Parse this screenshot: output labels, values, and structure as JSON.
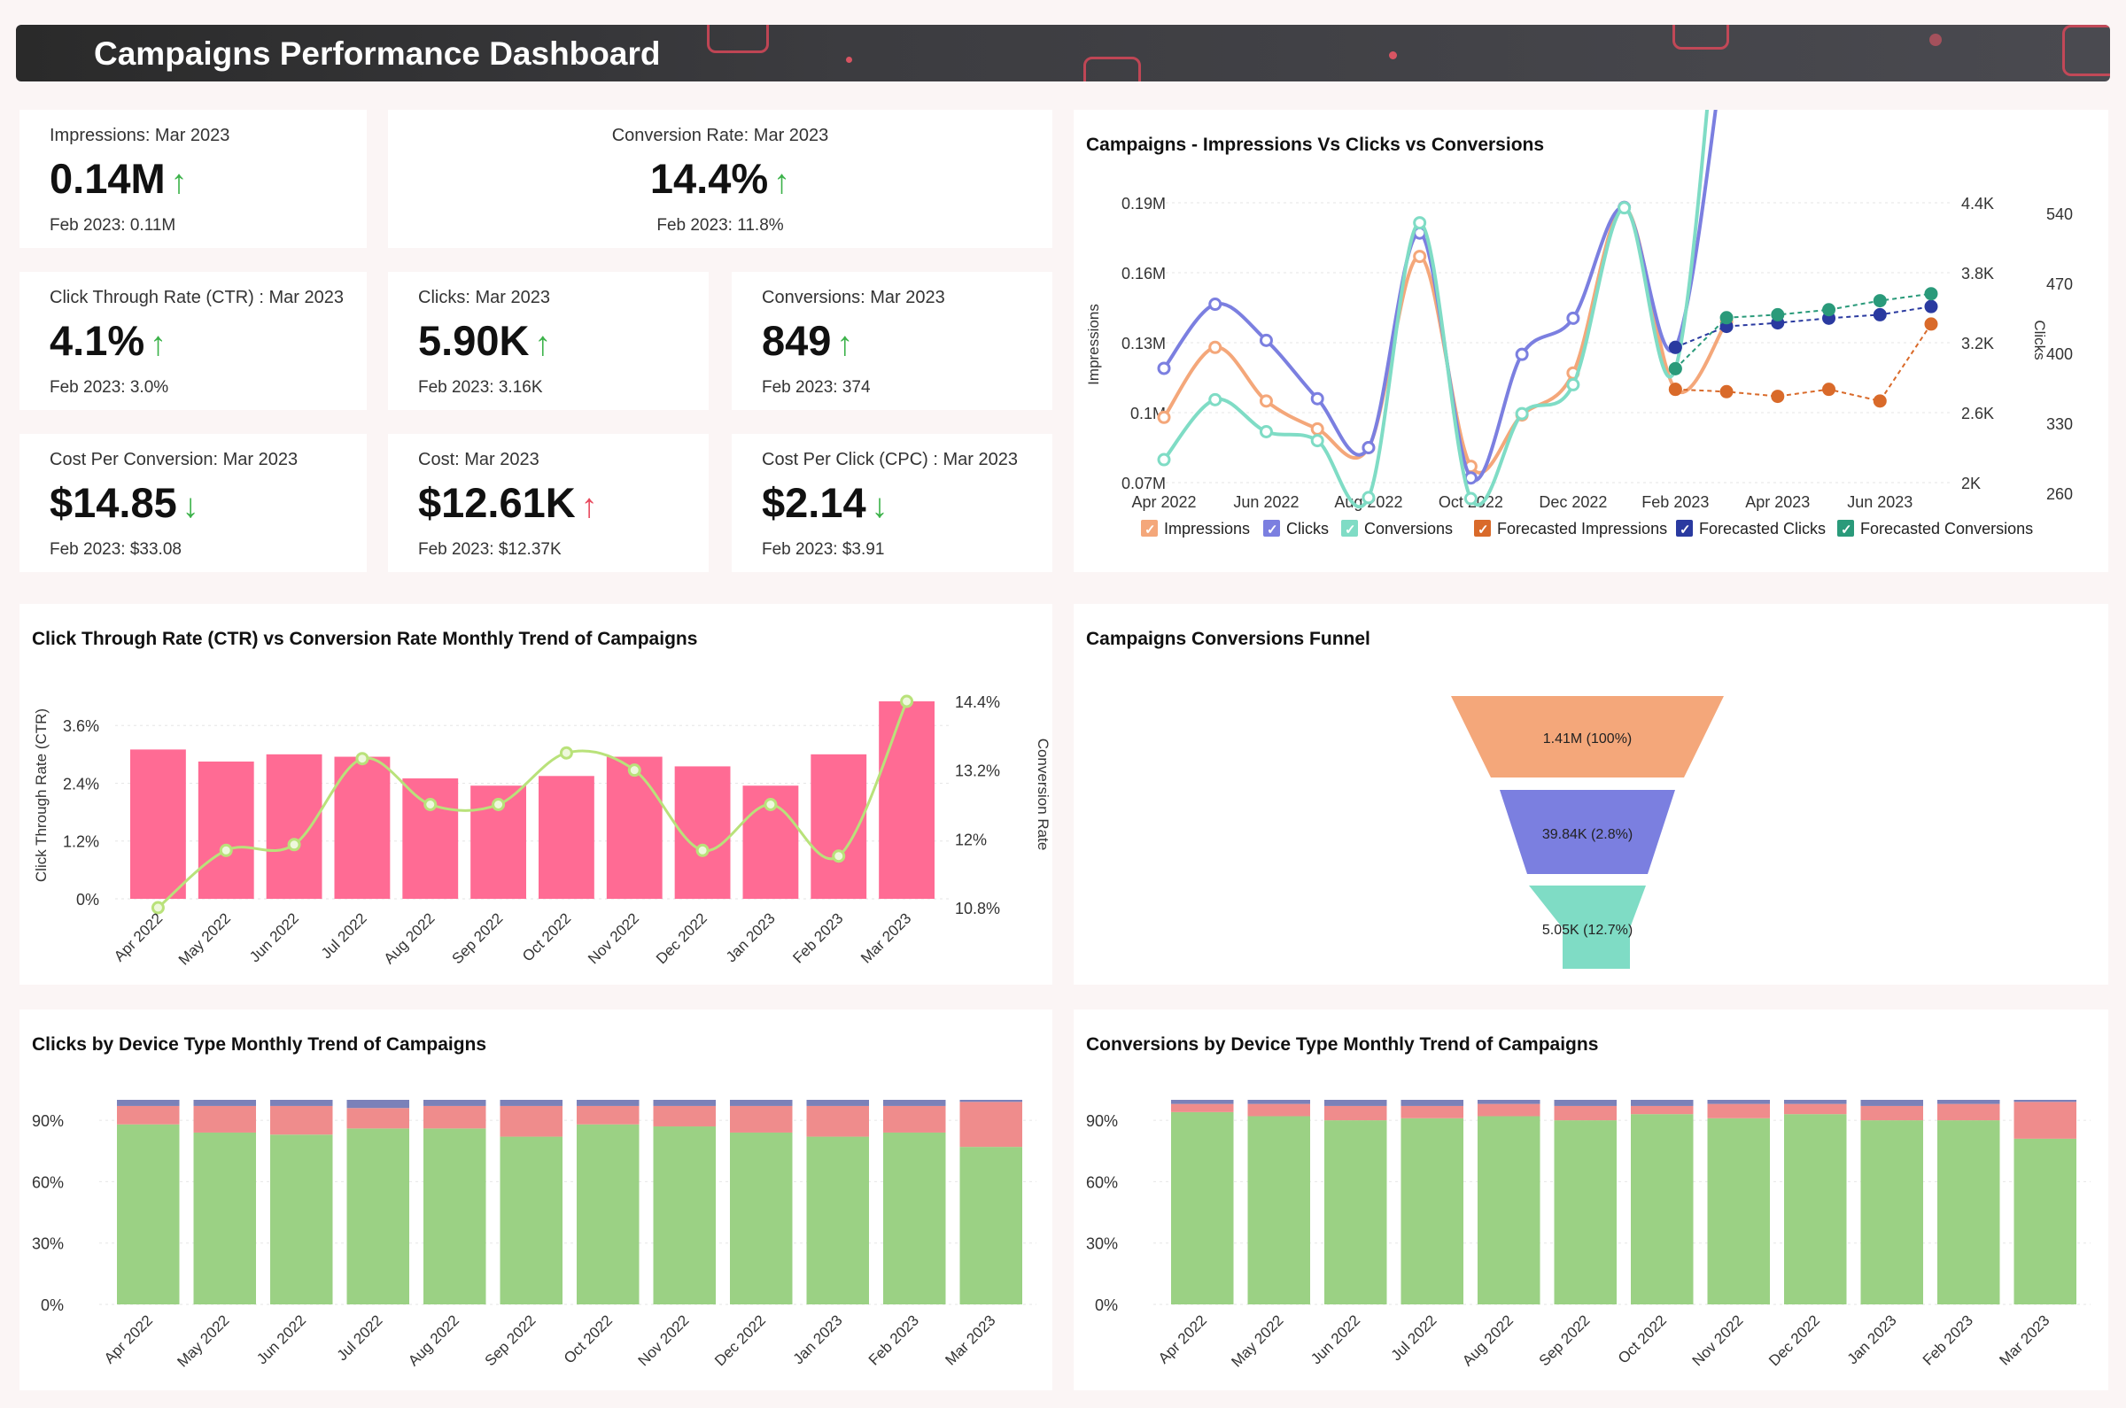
{
  "header": {
    "title": "Campaigns Performance Dashboard"
  },
  "kpis": {
    "impressions": {
      "label": "Impressions: Mar 2023",
      "value": "0.14M",
      "arrow": "↑",
      "prev": "Feb 2023: 0.11M"
    },
    "conversion_rate": {
      "label": "Conversion Rate: Mar 2023",
      "value": "14.4%",
      "arrow": "↑",
      "prev": "Feb 2023: 11.8%"
    },
    "ctr": {
      "label": "Click Through Rate (CTR) : Mar 2023",
      "value": "4.1%",
      "arrow": "↑",
      "prev": "Feb 2023: 3.0%"
    },
    "clicks": {
      "label": "Clicks: Mar 2023",
      "value": "5.90K",
      "arrow": "↑",
      "prev": "Feb 2023: 3.16K"
    },
    "conversions": {
      "label": "Conversions: Mar 2023",
      "value": "849",
      "arrow": "↑",
      "prev": "Feb 2023: 374"
    },
    "cost_per_conversion": {
      "label": "Cost Per Conversion: Mar 2023",
      "value": "$14.85",
      "arrow": "↓",
      "prev": "Feb 2023: $33.08"
    },
    "cost": {
      "label": "Cost: Mar 2023",
      "value": "$12.61K",
      "arrow": "↑",
      "prev": "Feb 2023: $12.37K"
    },
    "cpc": {
      "label": "Cost Per Click (CPC) : Mar 2023",
      "value": "$2.14",
      "arrow": "↓",
      "prev": "Feb 2023: $3.91"
    }
  },
  "colors": {
    "orange": "#f4a77a",
    "purple": "#7b7fe0",
    "teal": "#7fdcc5",
    "pink": "#ff6b94",
    "lightgreen": "#b9e27a",
    "green": "#9bd184",
    "red": "#ef8c8c",
    "slate": "#7b81b9",
    "forecast_orange": "#d96a2a",
    "forecast_blue": "#2a3aa0",
    "forecast_teal": "#2a9a7a"
  },
  "chart_data": [
    {
      "id": "impressions_clicks_conversions",
      "type": "line",
      "title": "Campaigns - Impressions Vs Clicks vs Conversions",
      "x_tick_labels": [
        "Apr 2022",
        "Jun 2022",
        "Aug 2022",
        "Oct 2022",
        "Dec 2022",
        "Feb 2023",
        "Apr 2023",
        "Jun 2023"
      ],
      "months": [
        "Apr 2022",
        "May 2022",
        "Jun 2022",
        "Jul 2022",
        "Aug 2022",
        "Sep 2022",
        "Oct 2022",
        "Nov 2022",
        "Dec 2022",
        "Jan 2023",
        "Feb 2023",
        "Mar 2023",
        "Apr 2023",
        "May 2023",
        "Jun 2023",
        "Jul 2023"
      ],
      "y_left": {
        "label": "Impressions",
        "ticks": [
          "0.19M",
          "0.16M",
          "0.13M",
          "0.1M",
          "0.07M"
        ],
        "range": [
          70000,
          190000
        ]
      },
      "y_right1": {
        "label": "Clicks",
        "ticks": [
          "4.4K",
          "3.8K",
          "3.2K",
          "2.6K",
          "2K"
        ],
        "range": [
          2000,
          4400
        ]
      },
      "y_right2": {
        "label": "Conversions",
        "ticks": [
          "540",
          "470",
          "400",
          "330",
          "260"
        ],
        "range": [
          260,
          540
        ]
      },
      "series": [
        {
          "name": "Impressions",
          "axis": "left",
          "values": [
            98000,
            128000,
            105000,
            93000,
            85000,
            167000,
            77000,
            99000,
            117000,
            188000,
            110000,
            139000
          ]
        },
        {
          "name": "Clicks",
          "axis": "right1",
          "values": [
            2980,
            3530,
            3220,
            2720,
            2300,
            4140,
            2040,
            3100,
            3410,
            4360,
            3160,
            5900
          ]
        },
        {
          "name": "Conversions",
          "axis": "right2",
          "values": [
            283,
            343,
            311,
            302,
            245,
            520,
            244,
            329,
            358,
            535,
            374,
            849
          ]
        },
        {
          "name": "Forecasted Impressions",
          "axis": "left",
          "x_start": 10,
          "values": [
            110000,
            109000,
            107000,
            110000,
            105000,
            138000
          ]
        },
        {
          "name": "Forecasted Clicks",
          "axis": "right1",
          "x_start": 10,
          "values": [
            3160,
            3340,
            3370,
            3410,
            3440,
            3510
          ]
        },
        {
          "name": "Forecasted Conversions",
          "axis": "right2",
          "x_start": 10,
          "values": [
            374,
            425,
            428,
            433,
            442,
            449
          ]
        }
      ],
      "legend": [
        "Impressions",
        "Clicks",
        "Conversions",
        "Forecasted Impressions",
        "Forecasted Clicks",
        "Forecasted Conversions"
      ],
      "legend_position": "bottom"
    },
    {
      "id": "ctr_vs_cr",
      "type": "bar",
      "title": "Click Through Rate (CTR) vs Conversion Rate Monthly Trend of Campaigns",
      "categories": [
        "Apr 2022",
        "May 2022",
        "Jun 2022",
        "Jul 2022",
        "Aug 2022",
        "Sep 2022",
        "Oct 2022",
        "Nov 2022",
        "Dec 2022",
        "Jan 2023",
        "Feb 2023",
        "Mar 2023"
      ],
      "ylabel": "Click Through Rate (CTR)",
      "y_ticks": [
        "3.6%",
        "2.4%",
        "1.2%",
        "0%"
      ],
      "ylim": [
        0,
        4.1
      ],
      "y2label": "Conversion Rate",
      "y2_ticks": [
        "14.4%",
        "13.2%",
        "12%",
        "10.8%"
      ],
      "y2lim": [
        10.8,
        14.4
      ],
      "series": [
        {
          "name": "Click Through Rate (CTR)",
          "type": "bar",
          "values": [
            3.1,
            2.85,
            3.0,
            2.95,
            2.5,
            2.35,
            2.55,
            2.95,
            2.75,
            2.35,
            3.0,
            4.1
          ]
        },
        {
          "name": "Conversion Rate",
          "type": "line",
          "values": [
            10.8,
            11.8,
            11.9,
            13.4,
            12.6,
            12.6,
            13.5,
            13.2,
            11.8,
            12.6,
            11.7,
            14.4
          ]
        }
      ]
    },
    {
      "id": "funnel",
      "type": "funnel",
      "title": "Campaigns Conversions Funnel",
      "stages": [
        {
          "value": 1410000,
          "label": "1.41M (100%)"
        },
        {
          "value": 39840,
          "label": "39.84K (2.8%)"
        },
        {
          "value": 5050,
          "label": "5.05K (12.7%)"
        }
      ]
    },
    {
      "id": "clicks_by_device",
      "type": "bar",
      "stacked": true,
      "title": "Clicks by Device Type Monthly Trend of Campaigns",
      "categories": [
        "Apr 2022",
        "May 2022",
        "Jun 2022",
        "Jul 2022",
        "Aug 2022",
        "Sep 2022",
        "Oct 2022",
        "Nov 2022",
        "Dec 2022",
        "Jan 2023",
        "Feb 2023",
        "Mar 2023"
      ],
      "y_ticks": [
        "90%",
        "60%",
        "30%",
        "0%"
      ],
      "ylim": [
        0,
        100
      ],
      "series": [
        {
          "values": [
            88,
            84,
            83,
            86,
            86,
            82,
            88,
            87,
            84,
            82,
            84,
            77
          ]
        },
        {
          "values": [
            9,
            13,
            14,
            10,
            11,
            15,
            9,
            10,
            13,
            15,
            13,
            22
          ]
        },
        {
          "values": [
            3,
            3,
            3,
            4,
            3,
            3,
            3,
            3,
            3,
            3,
            3,
            1
          ]
        }
      ]
    },
    {
      "id": "conversions_by_device",
      "type": "bar",
      "stacked": true,
      "title": "Conversions by Device Type Monthly Trend of Campaigns",
      "categories": [
        "Apr 2022",
        "May 2022",
        "Jun 2022",
        "Jul 2022",
        "Aug 2022",
        "Sep 2022",
        "Oct 2022",
        "Nov 2022",
        "Dec 2022",
        "Jan 2023",
        "Feb 2023",
        "Mar 2023"
      ],
      "y_ticks": [
        "90%",
        "60%",
        "30%",
        "0%"
      ],
      "ylim": [
        0,
        100
      ],
      "series": [
        {
          "values": [
            94,
            92,
            90,
            91,
            92,
            90,
            93,
            91,
            93,
            90,
            90,
            81
          ]
        },
        {
          "values": [
            4,
            6,
            7,
            6,
            6,
            7,
            4,
            7,
            5,
            7,
            8,
            18
          ]
        },
        {
          "values": [
            2,
            2,
            3,
            3,
            2,
            3,
            3,
            2,
            2,
            3,
            2,
            1
          ]
        }
      ]
    }
  ]
}
